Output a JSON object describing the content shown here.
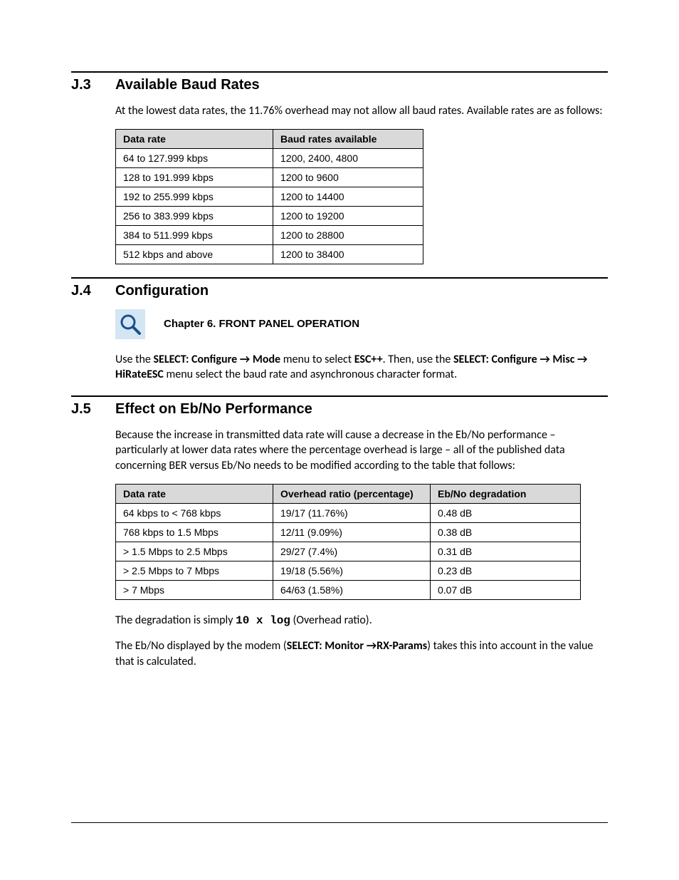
{
  "sections": {
    "j3": {
      "num": "J.3",
      "title": "Available Baud Rates"
    },
    "j4": {
      "num": "J.4",
      "title": "Configuration"
    },
    "j5": {
      "num": "J.5",
      "title": "Effect on Eb/No Performance"
    }
  },
  "j3_intro": "At the lowest data rates, the 11.76% overhead may not allow all baud rates. Available rates are as follows:",
  "table1": {
    "headers": [
      "Data rate",
      "Baud rates available"
    ],
    "rows": [
      [
        "64 to 127.999 kbps",
        "1200, 2400, 4800"
      ],
      [
        "128 to 191.999 kbps",
        "1200 to 9600"
      ],
      [
        "192 to 255.999 kbps",
        "1200 to 14400"
      ],
      [
        "256 to 383.999 kbps",
        "1200 to 19200"
      ],
      [
        "384 to 511.999 kbps",
        "1200 to 28800"
      ],
      [
        "512 kbps and above",
        "1200 to 38400"
      ]
    ]
  },
  "j4_ref": "Chapter 6. FRONT PANEL OPERATION",
  "j4_text": {
    "pre1": "Use the ",
    "b1": "SELECT: Configure ",
    "b2": " Mode",
    "mid1": " menu to select ",
    "b3": "ESC++",
    "mid2": ". Then, use the ",
    "b4": "SELECT: Configure ",
    "b5": " Misc ",
    "b6": " HiRateESC",
    "post": " menu select the baud rate and asynchronous character format."
  },
  "arrow": "→",
  "j5_intro": "Because the increase in transmitted data rate will cause a decrease in the Eb/No performance – particularly at lower data rates where the percentage overhead is large – all of the published data concerning BER versus Eb/No needs to be modified according to the table that follows:",
  "table2": {
    "headers": [
      "Data rate",
      "Overhead ratio (percentage)",
      "Eb/No degradation"
    ],
    "rows": [
      [
        "64 kbps to < 768 kbps",
        "19/17 (11.76%)",
        "0.48 dB"
      ],
      [
        "768 kbps to 1.5 Mbps",
        "12/11 (9.09%)",
        "0.38 dB"
      ],
      [
        "> 1.5 Mbps to 2.5 Mbps",
        "29/27 (7.4%)",
        "0.31 dB"
      ],
      [
        "> 2.5 Mbps to 7 Mbps",
        "19/18 (5.56%)",
        "0.23 dB"
      ],
      [
        "> 7 Mbps",
        "64/63 (1.58%)",
        "0.07 dB"
      ]
    ]
  },
  "j5_post1": {
    "pre": "The degradation is simply ",
    "mono": "10 x log",
    "post": " (Overhead ratio)."
  },
  "j5_post2": {
    "pre": "The Eb/No displayed by the modem (",
    "b1": "SELECT: Monitor ",
    "b2": "RX-Params",
    "post": ") takes this into account in the value that is calculated."
  }
}
